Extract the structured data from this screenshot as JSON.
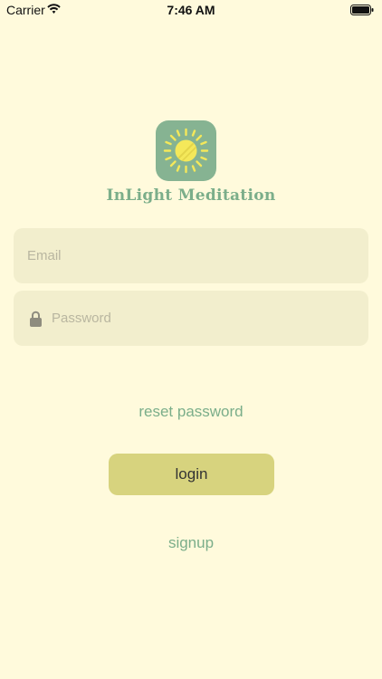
{
  "status_bar": {
    "carrier": "Carrier",
    "time": "7:46 AM"
  },
  "app": {
    "name": "InLight Meditation"
  },
  "form": {
    "email_placeholder": "Email",
    "password_placeholder": "Password"
  },
  "actions": {
    "reset_label": "reset password",
    "login_label": "login",
    "signup_label": "signup"
  },
  "colors": {
    "background": "#FFFADC",
    "field_bg": "#F2EECD",
    "accent_green": "#7BAE8A",
    "logo_bg": "#86B392",
    "button_bg": "#D7D37E",
    "sun_yellow": "#F4E85A"
  },
  "icons": {
    "logo": "sun-icon",
    "lock": "lock-icon",
    "wifi": "wifi-icon",
    "battery": "battery-icon"
  }
}
